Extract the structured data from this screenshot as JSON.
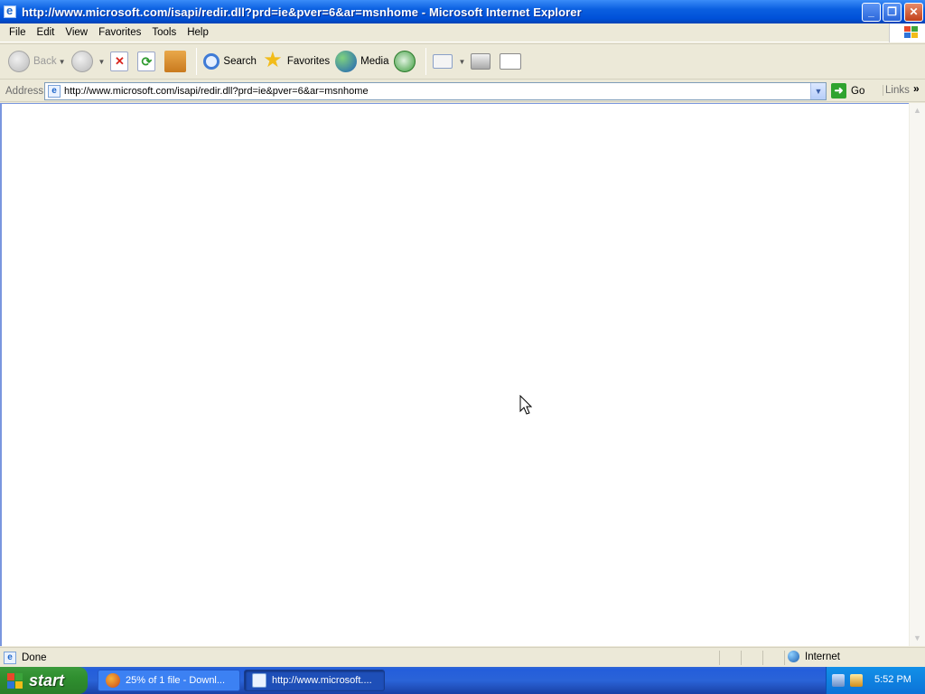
{
  "window": {
    "title": "http://www.microsoft.com/isapi/redir.dll?prd=ie&pver=6&ar=msnhome - Microsoft Internet Explorer"
  },
  "menu": [
    "File",
    "Edit",
    "View",
    "Favorites",
    "Tools",
    "Help"
  ],
  "toolbar": {
    "back": "Back",
    "search": "Search",
    "favorites": "Favorites",
    "media": "Media"
  },
  "address": {
    "label": "Address",
    "url": "http://www.microsoft.com/isapi/redir.dll?prd=ie&pver=6&ar=msnhome",
    "go": "Go",
    "links": "Links",
    "more": "»"
  },
  "status": {
    "text": "Done",
    "zone": "Internet"
  },
  "taskbar": {
    "start": "start",
    "tasks": [
      {
        "label": "25% of 1 file - Downl..."
      },
      {
        "label": "http://www.microsoft...."
      }
    ],
    "clock": "5:52 PM"
  },
  "colors": {
    "titlebar": "#0A5FE0",
    "taskbar": "#245EDB",
    "start": "#2F8F2F",
    "chrome": "#ECE9D8"
  }
}
